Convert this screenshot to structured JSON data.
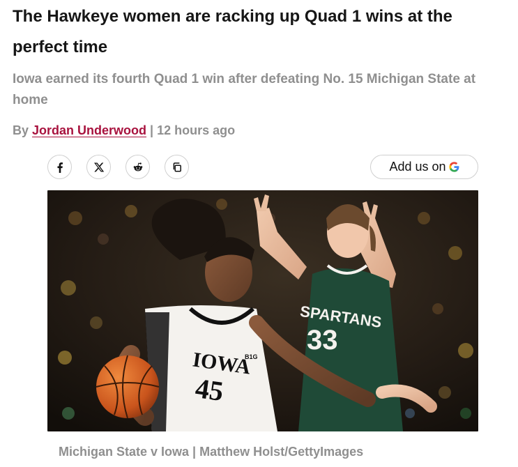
{
  "article": {
    "headline": "The Hawkeye women are racking up Quad 1 wins at the perfect time",
    "dek": "Iowa earned its fourth Quad 1 win after defeating No. 15 Michigan State at home",
    "byline": {
      "prefix": "By ",
      "author": "Jordan Underwood",
      "separator": " | ",
      "timestamp": "12 hours ago"
    }
  },
  "share": {
    "buttons": [
      {
        "icon": "facebook-icon",
        "label": "f"
      },
      {
        "icon": "x-icon",
        "label": "X"
      },
      {
        "icon": "reddit-icon",
        "label": ""
      },
      {
        "icon": "copy-link-icon",
        "label": ""
      }
    ],
    "add_us_label": "Add us on",
    "add_us_icon": "google-icon"
  },
  "image": {
    "jersey_left_team": "IOWA",
    "jersey_left_number": "45",
    "jersey_right_team": "SPARTANS",
    "jersey_right_number": "33",
    "conference_patch": "B1G"
  },
  "caption": "Michigan State v Iowa | Matthew Holst/GettyImages",
  "colors": {
    "author_link": "#a8123e",
    "muted_text": "#8f8f8f",
    "iowa_black": "#111111",
    "iowa_white": "#f4f2ee",
    "spartan_green": "#1f4a37"
  }
}
